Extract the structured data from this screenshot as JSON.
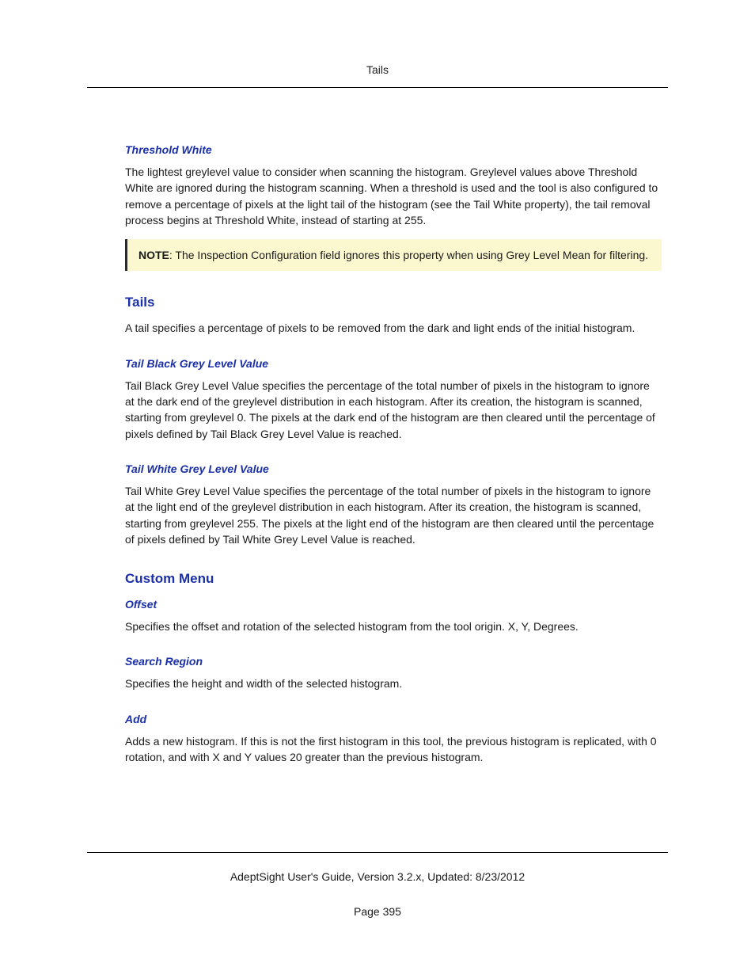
{
  "header": {
    "title": "Tails"
  },
  "sections": {
    "thresholdWhite": {
      "heading": "Threshold White",
      "body": "The lightest greylevel value to consider when scanning the histogram. Greylevel values above Threshold White are ignored during the histogram scanning. When a threshold is used and the tool is also configured to remove a percentage of pixels at the light tail of the histogram (see the Tail White property), the tail removal process begins at Threshold White, instead of starting at 255.",
      "note_label": "NOTE",
      "note_body": ": The Inspection Configuration field ignores this property when using Grey Level Mean for filtering."
    },
    "tails": {
      "heading": "Tails",
      "body": "A tail specifies a percentage of pixels to be removed from the dark and light ends of the initial histogram."
    },
    "tailBlack": {
      "heading": "Tail Black Grey Level Value",
      "body": "Tail Black Grey Level Value specifies the percentage of the total number of pixels in the histogram to ignore at the dark end of the greylevel distribution in each histogram. After its creation, the histogram is scanned, starting from greylevel 0. The pixels at the dark end of the histogram are then cleared until the percentage of pixels defined by Tail Black Grey Level Value is reached."
    },
    "tailWhite": {
      "heading": "Tail White Grey Level Value",
      "body": "Tail White Grey Level Value specifies the percentage of the total number of pixels in the histogram to ignore at the light end of the greylevel distribution in each histogram. After its creation, the histogram is scanned, starting from greylevel 255. The pixels at the light end of the histogram are then cleared until the percentage of pixels defined by Tail White Grey Level Value is reached."
    },
    "customMenu": {
      "heading": "Custom Menu"
    },
    "offset": {
      "heading": "Offset",
      "body": "Specifies the offset and rotation of the selected histogram from the tool origin. X, Y, Degrees."
    },
    "searchRegion": {
      "heading": "Search Region",
      "body": "Specifies the height and width of the selected histogram."
    },
    "add": {
      "heading": "Add",
      "body": "Adds a new histogram. If this is not the first histogram in this tool, the previous histogram is replicated, with 0 rotation, and with X and Y values 20 greater than the previous histogram."
    }
  },
  "footer": {
    "guide": "AdeptSight User's Guide,  Version 3.2.x, Updated: 8/23/2012",
    "page": "Page 395"
  }
}
